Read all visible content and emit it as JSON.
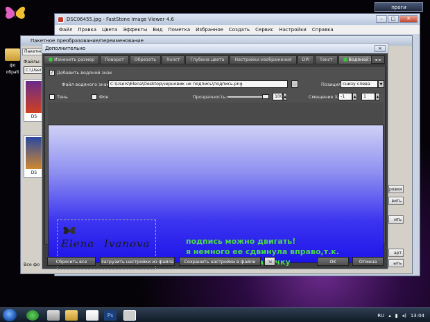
{
  "desktop": {
    "folder_label_line1": "фо",
    "folder_label_line2": "обраб",
    "progi_button": "проги"
  },
  "main_window": {
    "title": "DSC06455.jpg  -  FastStone Image Viewer 4.6",
    "menu": [
      "Файл",
      "Правка",
      "Цвета",
      "Эффекты",
      "Вид",
      "Пометка",
      "Избранное",
      "Создать",
      "Сервис",
      "Настройки",
      "Справка"
    ]
  },
  "batch_window": {
    "title": "Пакетное преобразование/переименование",
    "tab_label": "Пакетно",
    "files_label": "Файлы:",
    "path_field": "C:\\Users",
    "thumb_labels": [
      "DS",
      "DS"
    ],
    "right_buttons": [
      "ровки",
      "вить",
      "ить",
      "арт",
      "ыть"
    ],
    "bottom_text": "Все фо"
  },
  "dialog": {
    "title": "Дополнительно",
    "close_glyph": "×",
    "tabs": [
      {
        "label": "Изменить размер",
        "active": false,
        "dot": true
      },
      {
        "label": "Поворот",
        "active": false,
        "dot": false
      },
      {
        "label": "Обрезать",
        "active": false,
        "dot": false
      },
      {
        "label": "Холст",
        "active": false,
        "dot": false
      },
      {
        "label": "Глубина цвета",
        "active": false,
        "dot": false
      },
      {
        "label": "Настройки изображения",
        "active": false,
        "dot": false
      },
      {
        "label": "DPI",
        "active": false,
        "dot": false
      },
      {
        "label": "Текст",
        "active": false,
        "dot": false
      },
      {
        "label": "Водяной знак",
        "active": true,
        "dot": true
      }
    ],
    "tab_scroll": "◄ ►",
    "watermark": {
      "add_label": "Добавить водяной знак",
      "add_checked": true,
      "file_label": "Файл водяного знака:",
      "file_path": "C:\\Users\\Elena\\Desktop\\черновик нк подпись\\подпись.png",
      "position_label": "Позиция:",
      "position_value": "снизу слева",
      "shadow_label": "Тень",
      "shadow_checked": false,
      "background_label": "Фон",
      "background_checked": false,
      "opacity_label": "Прозрачность:",
      "opacity_value": "100",
      "opacity_level": 1.0,
      "offset_label": "Смещение X/Y:",
      "offset_x": "-1",
      "offset_y": "1"
    },
    "preview": {
      "watermark_word1": "Elena",
      "watermark_word2": "Ivanova",
      "message_lines": [
        "подпись можно двигать!",
        "я немного ее сдвинула вправо,т.к.",
        "хочу добавить рамочку"
      ]
    },
    "buttons": {
      "reset": "Сбросить все",
      "load": "Загрузить настройки из файла",
      "save": "Сохранить настройки в файле",
      "ok": "OK",
      "cancel": "Отмена"
    }
  },
  "taskbar": {
    "lang": "RU",
    "time": "13:04"
  },
  "colors": {
    "message_green": "#4cd94c",
    "preview_top": "#cfd1f6",
    "preview_bottom": "#1d14e8"
  }
}
